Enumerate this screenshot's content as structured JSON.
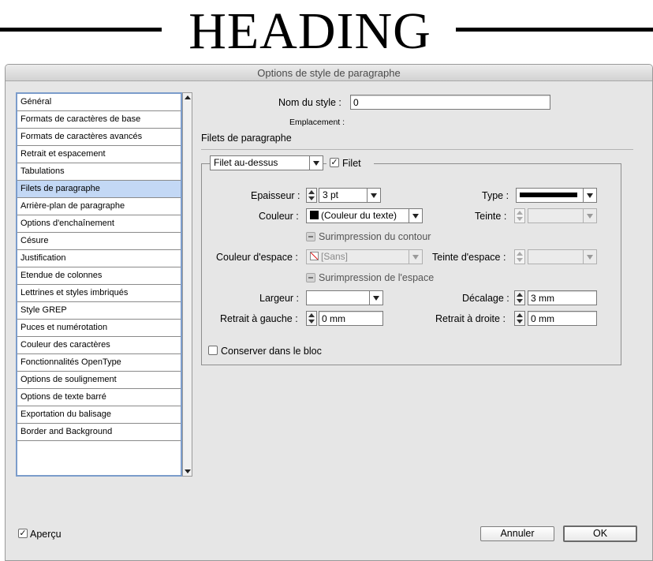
{
  "document": {
    "heading": "HEADING"
  },
  "dialog": {
    "title": "Options de style de paragraphe",
    "categories": [
      "Général",
      "Formats de caractères de base",
      "Formats de caractères avancés",
      "Retrait et espacement",
      "Tabulations",
      "Filets de paragraphe",
      "Arrière-plan de paragraphe",
      "Options d'enchaînement",
      "Césure",
      "Justification",
      "Etendue de colonnes",
      "Lettrines et styles imbriqués",
      "Style GREP",
      "Puces et numérotation",
      "Couleur des caractères",
      "Fonctionnalités OpenType",
      "Options de soulignement",
      "Options de texte barré",
      "Exportation du balisage",
      "Border and Background"
    ],
    "selected_category": "Filets de paragraphe",
    "style_name_label": "Nom du style :",
    "style_name_value": "0",
    "location_label": "Emplacement :",
    "section_title": "Filets de paragraphe",
    "rule_position": {
      "value": "Filet au-dessus",
      "options_visible": [
        "Filet au-dessus"
      ]
    },
    "rule_on": {
      "label": "Filet",
      "checked": true
    },
    "weight": {
      "label": "Epaisseur :",
      "value": "3 pt"
    },
    "type": {
      "label": "Type :",
      "sample": "solid-line"
    },
    "color": {
      "label": "Couleur :",
      "value": "(Couleur du texte)",
      "swatch": "#000000"
    },
    "tint": {
      "label": "Teinte :",
      "value": ""
    },
    "overprint_stroke": {
      "label": "Surimpression du contour",
      "enabled": false
    },
    "gap_color": {
      "label": "Couleur d'espace :",
      "value": "[Sans]"
    },
    "gap_tint": {
      "label": "Teinte d'espace :",
      "value": ""
    },
    "overprint_gap": {
      "label": "Surimpression de l'espace",
      "enabled": false
    },
    "width": {
      "label": "Largeur :",
      "value": ""
    },
    "offset": {
      "label": "Décalage :",
      "value": "3 mm"
    },
    "left_indent": {
      "label": "Retrait à gauche :",
      "value": "0 mm"
    },
    "right_indent": {
      "label": "Retrait à droite :",
      "value": "0 mm"
    },
    "keep_in_frame": {
      "label": "Conserver dans le bloc",
      "checked": false
    },
    "preview": {
      "label": "Aperçu",
      "checked": true
    },
    "cancel_label": "Annuler",
    "ok_label": "OK"
  }
}
